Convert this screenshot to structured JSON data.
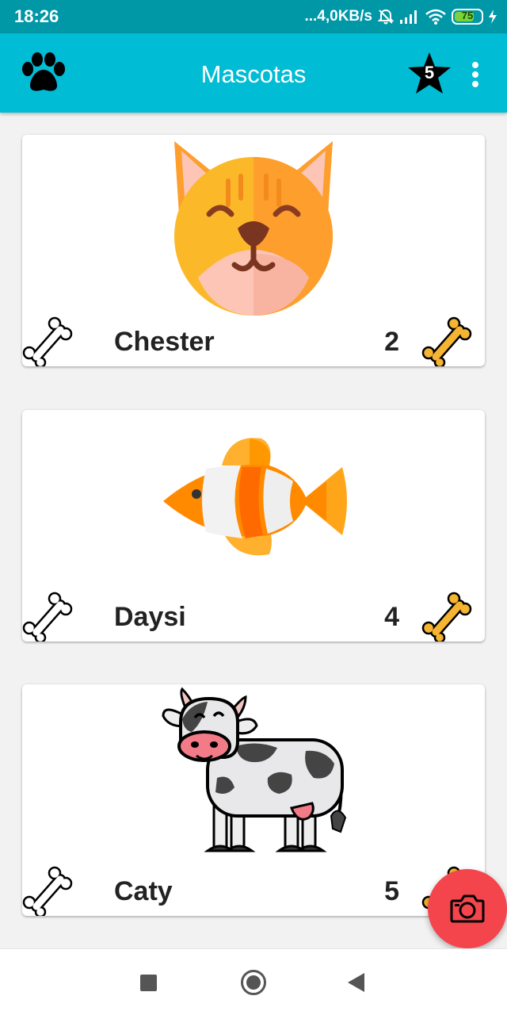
{
  "status_bar": {
    "time": "18:26",
    "network_speed": "...4,0KB/s",
    "battery_level": "75",
    "battery_fraction": 0.75
  },
  "app_bar": {
    "title": "Mascotas",
    "logo_icon": "paw-icon",
    "rating_icon": "star-icon",
    "rating_value": "5",
    "menu_icon": "more-vert-icon"
  },
  "pets": [
    {
      "name": "Chester",
      "count": "2",
      "image": "cat-face"
    },
    {
      "name": "Daysi",
      "count": "4",
      "image": "clownfish"
    },
    {
      "name": "Caty",
      "count": "5",
      "image": "cow"
    }
  ],
  "fab": {
    "icon": "camera-icon"
  },
  "nav_bar": {
    "icons": [
      "recent-apps-icon",
      "home-icon",
      "back-icon"
    ]
  },
  "colors": {
    "status_bar": "#0097a7",
    "app_bar": "#00bcd4",
    "fab": "#f4454d",
    "bone_liked": "#f5b431"
  }
}
